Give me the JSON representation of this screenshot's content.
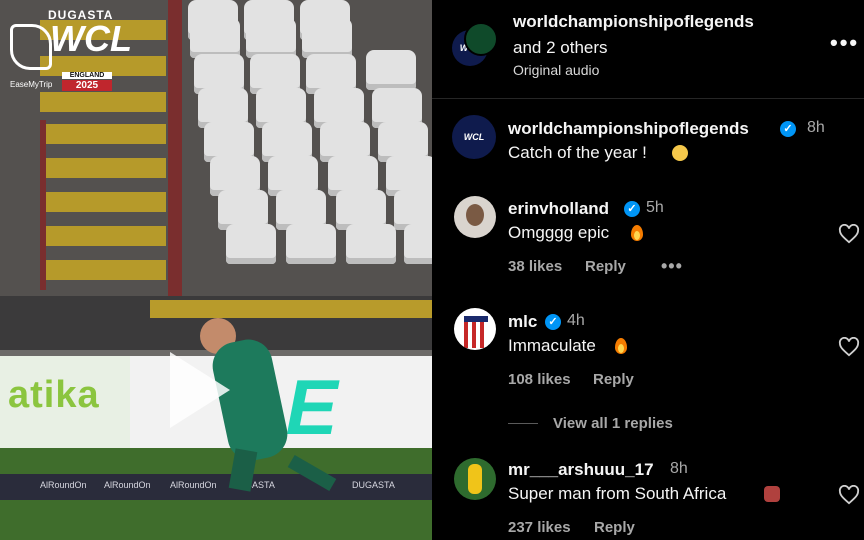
{
  "video": {
    "logo_brand": "DUGASTA",
    "logo_wcl": "WCL",
    "logo_country": "ENGLAND",
    "logo_year": "2025",
    "logo_sponsor": "EaseMyTrip",
    "ad_left": "atika",
    "ad_right": "LE",
    "strip_1": "AlRoundOn",
    "strip_2": "AlRoundOn",
    "strip_3": "AlRoundOn",
    "strip_4": "DUGASTA",
    "strip_5": "DUGASTA"
  },
  "header": {
    "author": "worldchampionshipoflegends",
    "collab": "and 2 others",
    "audio": "Original audio",
    "more_icon": "more-horizontal-icon"
  },
  "caption": {
    "username": "worldchampionshipoflegends",
    "time": "8h",
    "text": "Catch of the year !"
  },
  "comments": [
    {
      "username": "erinvholland",
      "time": "5h",
      "text": "Omgggg epic",
      "likes": "38 likes",
      "reply": "Reply"
    },
    {
      "username": "mlc",
      "time": "4h",
      "text": "Immaculate",
      "likes": "108 likes",
      "reply": "Reply",
      "view_replies": "View all 1 replies"
    },
    {
      "username": "mr___arshuuu_17",
      "time": "8h",
      "text": "Super man from South Africa",
      "likes": "237 likes",
      "reply": "Reply"
    }
  ],
  "colors": {
    "verified": "#0095f6",
    "background": "#000000",
    "muted": "#a8a8a8"
  }
}
